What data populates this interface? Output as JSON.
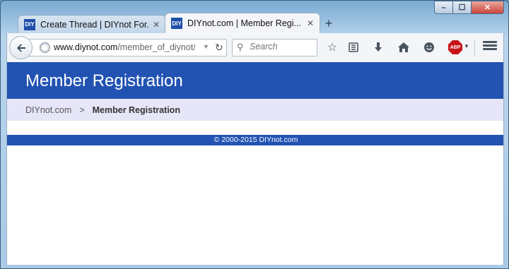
{
  "browser": {
    "window_controls": {
      "minimize": "–",
      "maximize": "☐",
      "close": "✕"
    },
    "tabs": [
      {
        "favicon": "DIY",
        "title": "Create Thread | DIYnot For...",
        "close": "✕"
      },
      {
        "favicon": "DIY",
        "title": "DIYnot.com | Member Regi...",
        "close": "✕"
      }
    ],
    "new_tab": "+",
    "url": {
      "domain": "www.diynot.com",
      "path": "/member_of_diynot/re"
    },
    "search": {
      "placeholder": "Search"
    },
    "toolbar_icons": [
      "bookmark-star-icon",
      "reading-list-icon",
      "download-icon",
      "home-icon",
      "hello-icon",
      "adblock-icon",
      "menu-icon"
    ],
    "adblock_label": "ABP"
  },
  "page": {
    "header_title": "Member Registration",
    "breadcrumb": {
      "home": "DIYnot.com",
      "separator": ">",
      "current": "Member Registration"
    },
    "footer": "© 2000-2015 DIYnot.com"
  },
  "colors": {
    "brand_blue": "#2253b3",
    "breadcrumb_bg": "#e6e6f8"
  }
}
